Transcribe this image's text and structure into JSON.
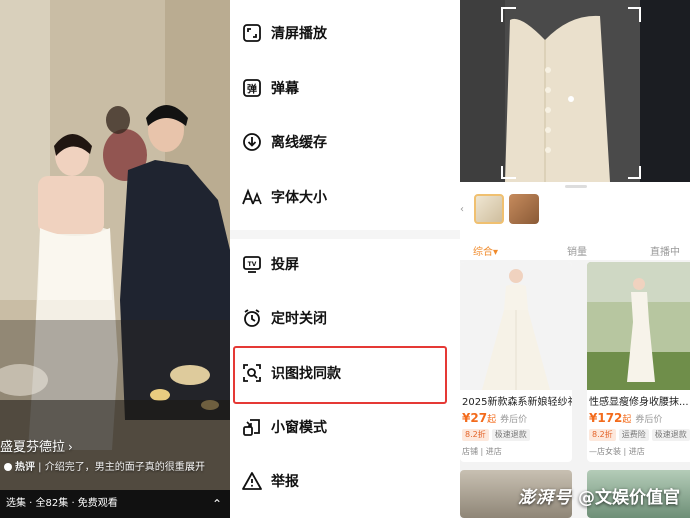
{
  "video": {
    "title": "盛夏芬德拉",
    "comment_label": "热评",
    "comment_text": "介绍完了，男主的面子真的很重...",
    "expand_label": "展开",
    "episode_bar": "选集 · 全82集 · 免费观看"
  },
  "menu": {
    "items": [
      {
        "label": "清屏播放",
        "icon": "fullscreen-corners-icon"
      },
      {
        "label": "弹幕",
        "icon": "danmaku-icon"
      },
      {
        "label": "离线缓存",
        "icon": "download-icon"
      },
      {
        "label": "字体大小",
        "icon": "font-size-icon"
      },
      {
        "label": "投屏",
        "icon": "tv-cast-icon"
      },
      {
        "label": "定时关闭",
        "icon": "alarm-clock-icon"
      },
      {
        "label": "识图找同款",
        "icon": "image-search-icon"
      },
      {
        "label": "小窗模式",
        "icon": "mini-window-icon"
      },
      {
        "label": "举报",
        "icon": "warning-triangle-icon"
      }
    ],
    "highlighted_item": "识图找同款",
    "highlight_color": "#e53935"
  },
  "shop": {
    "sort_tabs": [
      "综合▾",
      "销量",
      "直播中"
    ],
    "products": [
      {
        "title": "2025新款森系新娘轻纱礼...",
        "price": "¥27",
        "price_suffix": "起",
        "coupon": "券后价",
        "tags": [
          "8.2折",
          "极速退款"
        ],
        "shop": "店铺 | 进店"
      },
      {
        "title": "性感显瘦修身收腰抹...",
        "price": "¥172",
        "price_suffix": "起",
        "coupon": "券后价",
        "tags": [
          "8.2折",
          "运费险",
          "极速退款"
        ],
        "shop": "—店女装 | 进店"
      }
    ],
    "accent_color": "#f36b1c"
  },
  "watermark": {
    "brand": "澎湃号",
    "author": "@文娱价值官"
  }
}
